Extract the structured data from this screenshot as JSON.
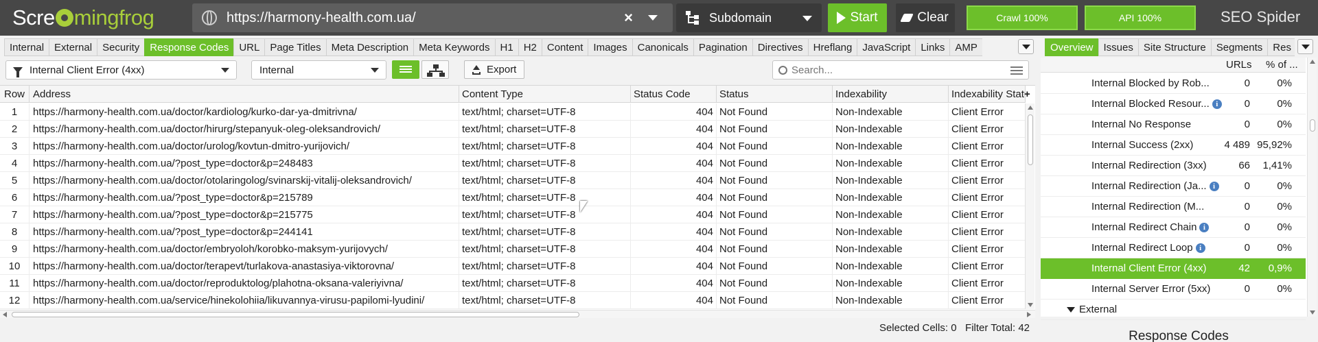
{
  "app": {
    "logo_pre": "Scre",
    "logo_post": "mingfrog",
    "product": "SEO Spider"
  },
  "toolbar": {
    "url": "https://harmony-health.com.ua/",
    "mode": "Subdomain",
    "start_label": "Start",
    "clear_label": "Clear",
    "crawl_progress": "Crawl 100%",
    "api_progress": "API 100%"
  },
  "tabs": [
    "Internal",
    "External",
    "Security",
    "Response Codes",
    "URL",
    "Page Titles",
    "Meta Description",
    "Meta Keywords",
    "H1",
    "H2",
    "Content",
    "Images",
    "Canonicals",
    "Pagination",
    "Directives",
    "Hreflang",
    "JavaScript",
    "Links",
    "AMP"
  ],
  "active_tab": "Response Codes",
  "filter": {
    "type": "Internal Client Error (4xx)",
    "scope": "Internal",
    "export_label": "Export",
    "search_placeholder": "Search..."
  },
  "table": {
    "columns": [
      "Row",
      "Address",
      "Content Type",
      "Status Code",
      "Status",
      "Indexability",
      "Indexability Status"
    ],
    "rows": [
      [
        "1",
        "https://harmony-health.com.ua/doctor/kardiolog/kurko-dar-ya-dmitrivna/",
        "text/html; charset=UTF-8",
        "404",
        "Not Found",
        "Non-Indexable",
        "Client Error"
      ],
      [
        "2",
        "https://harmony-health.com.ua/doctor/hirurg/stepanyuk-oleg-oleksandrovich/",
        "text/html; charset=UTF-8",
        "404",
        "Not Found",
        "Non-Indexable",
        "Client Error"
      ],
      [
        "3",
        "https://harmony-health.com.ua/doctor/urolog/kovtun-dmitro-yurijovich/",
        "text/html; charset=UTF-8",
        "404",
        "Not Found",
        "Non-Indexable",
        "Client Error"
      ],
      [
        "4",
        "https://harmony-health.com.ua/?post_type=doctor&p=248483",
        "text/html; charset=UTF-8",
        "404",
        "Not Found",
        "Non-Indexable",
        "Client Error"
      ],
      [
        "5",
        "https://harmony-health.com.ua/doctor/otolaringolog/svinarskij-vitalij-oleksandrovich/",
        "text/html; charset=UTF-8",
        "404",
        "Not Found",
        "Non-Indexable",
        "Client Error"
      ],
      [
        "6",
        "https://harmony-health.com.ua/?post_type=doctor&p=215789",
        "text/html; charset=UTF-8",
        "404",
        "Not Found",
        "Non-Indexable",
        "Client Error"
      ],
      [
        "7",
        "https://harmony-health.com.ua/?post_type=doctor&p=215775",
        "text/html; charset=UTF-8",
        "404",
        "Not Found",
        "Non-Indexable",
        "Client Error"
      ],
      [
        "8",
        "https://harmony-health.com.ua/?post_type=doctor&p=244141",
        "text/html; charset=UTF-8",
        "404",
        "Not Found",
        "Non-Indexable",
        "Client Error"
      ],
      [
        "9",
        "https://harmony-health.com.ua/doctor/embryoloh/korobko-maksym-yurijovych/",
        "text/html; charset=UTF-8",
        "404",
        "Not Found",
        "Non-Indexable",
        "Client Error"
      ],
      [
        "10",
        "https://harmony-health.com.ua/doctor/terapevt/turlakova-anastasiya-viktorovna/",
        "text/html; charset=UTF-8",
        "404",
        "Not Found",
        "Non-Indexable",
        "Client Error"
      ],
      [
        "11",
        "https://harmony-health.com.ua/doctor/reproduktolog/plahotna-oksana-valeriyivna/",
        "text/html; charset=UTF-8",
        "404",
        "Not Found",
        "Non-Indexable",
        "Client Error"
      ],
      [
        "12",
        "https://harmony-health.com.ua/service/hinekolohiia/likuvannya-virusu-papilomi-lyudini/",
        "text/html; charset=UTF-8",
        "404",
        "Not Found",
        "Non-Indexable",
        "Client Error"
      ]
    ]
  },
  "status_bar": {
    "selected_label": "Selected Cells:",
    "selected_value": "0",
    "filter_label": "Filter Total:",
    "filter_value": "42"
  },
  "right_panel": {
    "tabs": [
      "Overview",
      "Issues",
      "Site Structure",
      "Segments",
      "Res"
    ],
    "active_tab": "Overview",
    "col_urls": "URLs",
    "col_pct": "% of ...",
    "rows": [
      {
        "label": "Internal Blocked by Rob...",
        "info": false,
        "urls": "0",
        "pct": "0%"
      },
      {
        "label": "Internal Blocked Resour...",
        "info": true,
        "urls": "0",
        "pct": "0%"
      },
      {
        "label": "Internal No Response",
        "info": false,
        "urls": "0",
        "pct": "0%"
      },
      {
        "label": "Internal Success (2xx)",
        "info": false,
        "urls": "4 489",
        "pct": "95,92%"
      },
      {
        "label": "Internal Redirection (3xx)",
        "info": false,
        "urls": "66",
        "pct": "1,41%"
      },
      {
        "label": "Internal Redirection (Ja...",
        "info": true,
        "urls": "0",
        "pct": "0%"
      },
      {
        "label": "Internal Redirection (M...",
        "info": false,
        "urls": "0",
        "pct": "0%"
      },
      {
        "label": "Internal Redirect Chain",
        "info": true,
        "urls": "0",
        "pct": "0%"
      },
      {
        "label": "Internal Redirect Loop",
        "info": true,
        "urls": "0",
        "pct": "0%"
      },
      {
        "label": "Internal Client Error (4xx)",
        "info": false,
        "urls": "42",
        "pct": "0,9%",
        "selected": true
      },
      {
        "label": "Internal Server Error (5xx)",
        "info": false,
        "urls": "0",
        "pct": "0%"
      }
    ],
    "group_label": "External",
    "bottom_title": "Response Codes"
  },
  "colors": {
    "accent": "#6cbf2a",
    "topbar": "#474747",
    "info": "#4a7fc1"
  }
}
